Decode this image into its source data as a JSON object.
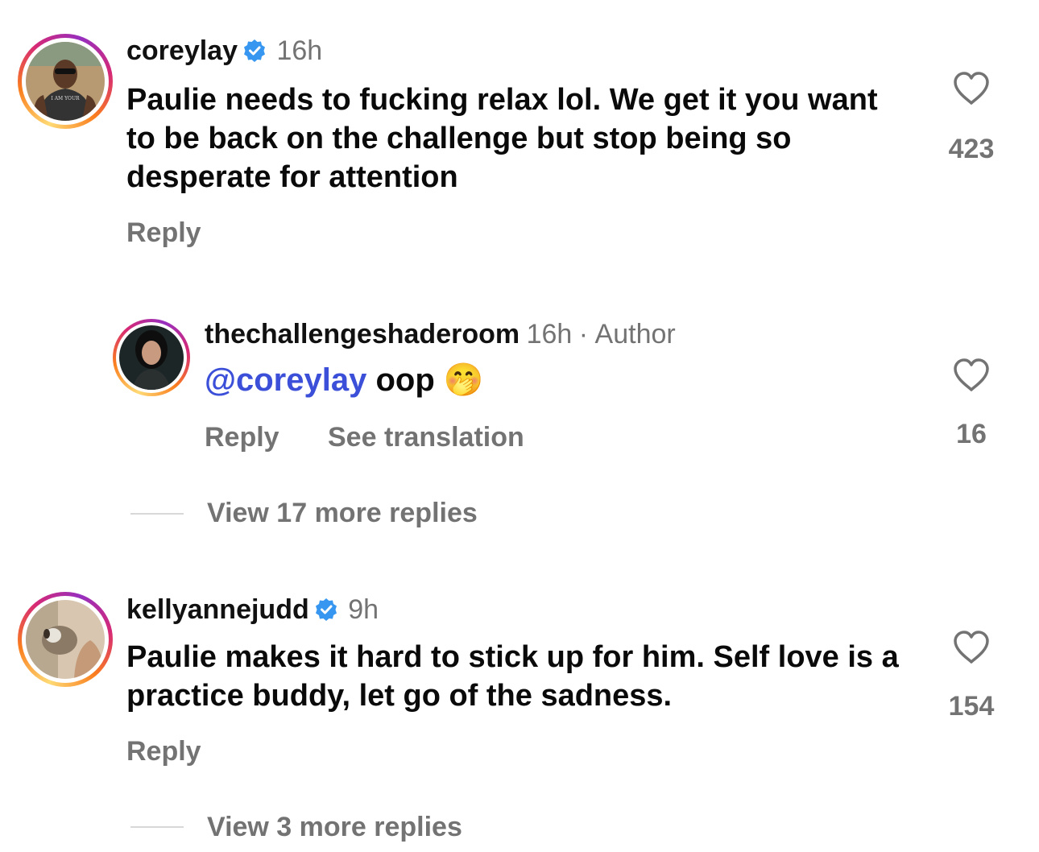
{
  "comments": [
    {
      "username": "coreylay",
      "time": "16h",
      "text": "Paulie needs to fucking relax lol. We get it you want to be back on the challenge but stop being so desperate for attention",
      "likes": "423",
      "reply_label": "Reply",
      "avatar_shirt_text": "I AM YOUR"
    },
    {
      "username": "thechallengeshaderoom",
      "time": "16h",
      "separator": "·",
      "author_label": "Author",
      "mention": "@coreylay",
      "text": "oop",
      "emoji": "🤭",
      "likes": "16",
      "reply_label": "Reply",
      "translate_label": "See translation",
      "view_more": "View 17 more replies"
    },
    {
      "username": "kellyannejudd",
      "time": "9h",
      "text": "Paulie makes it hard to stick up for him. Self love is a practice buddy, let go of the sadness.",
      "likes": "154",
      "reply_label": "Reply",
      "view_more": "View 3 more replies"
    }
  ],
  "icons": {
    "like": "heart-outline-icon",
    "verified": "verified-badge-icon"
  },
  "colors": {
    "verified": "#3797f0",
    "mention": "#3b4fd8",
    "secondary_text": "#737373"
  }
}
